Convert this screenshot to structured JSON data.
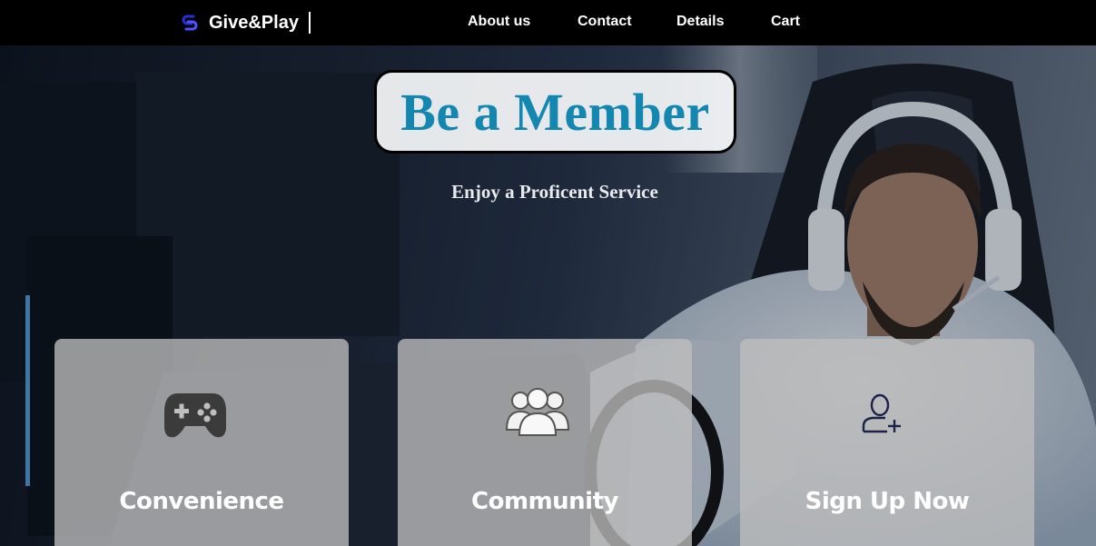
{
  "navbar": {
    "brand_name": "Give&Play",
    "links": [
      {
        "label": "About us"
      },
      {
        "label": "Contact"
      },
      {
        "label": "Details"
      },
      {
        "label": "Cart"
      }
    ]
  },
  "hero": {
    "title": "Be a Member",
    "subtitle": "Enjoy a Proficent Service"
  },
  "cards": [
    {
      "label": "Convenience",
      "icon": "gamepad-icon"
    },
    {
      "label": "Community",
      "icon": "community-icon"
    },
    {
      "label": "Sign Up Now",
      "icon": "add-user-icon"
    }
  ],
  "colors": {
    "navbar_bg": "#000000",
    "title_color": "#1487b0",
    "card_bg": "#bebebe",
    "logo_blue": "#2330d6"
  }
}
